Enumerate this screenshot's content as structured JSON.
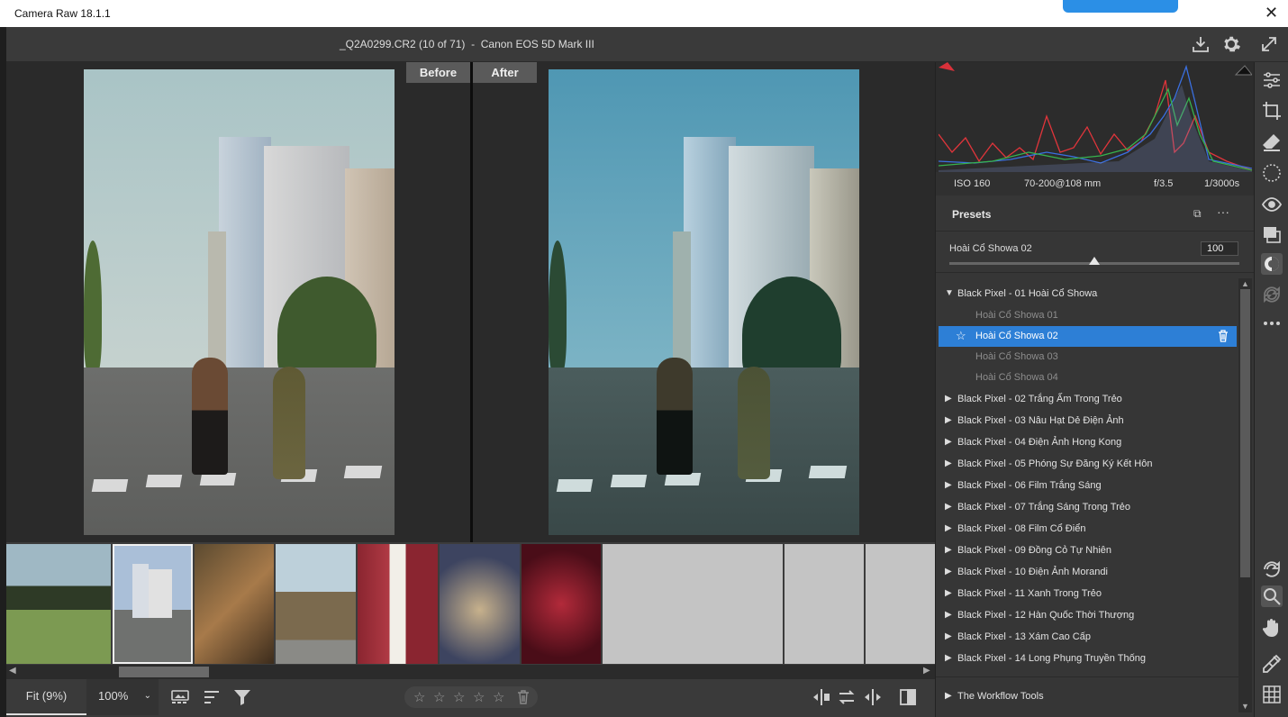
{
  "window": {
    "app_title": "Camera Raw 18.1.1"
  },
  "header": {
    "file_title": "_Q2A0299.CR2 (10 of 71)  -  Canon EOS 5D Mark III"
  },
  "preview": {
    "before_label": "Before",
    "after_label": "After"
  },
  "bottombar": {
    "zoom_fit": "Fit (9%)",
    "zoom_percent": "100%"
  },
  "camera_info": {
    "iso": "ISO 160",
    "lens": "70-200@108 mm",
    "aperture": "f/3.5",
    "shutter": "1/3000s"
  },
  "presets": {
    "title": "Presets",
    "selected_name": "Hoài Cổ Showa 02",
    "amount": "100",
    "amount_fraction": 0.5,
    "open_group": {
      "label": "Black Pixel - 01 Hoài Cổ Showa",
      "items": [
        "Hoài Cổ Showa 01",
        "Hoài Cổ Showa 02",
        "Hoài Cổ Showa 03",
        "Hoài Cổ Showa 04"
      ],
      "active_index": 1
    },
    "groups": [
      "Black Pixel - 02 Trắng Ấm Trong Trẻo",
      "Black Pixel - 03 Nâu Hạt Dẻ Điện Ảnh",
      "Black Pixel - 04 Điện Ảnh Hong Kong",
      "Black Pixel - 05 Phóng Sự Đăng Ký Kết Hôn",
      "Black Pixel - 06 Film Trắng Sáng",
      "Black Pixel - 07 Trắng Sáng Trong Trẻo",
      "Black Pixel - 08 Film Cổ Điển",
      "Black Pixel - 09 Đồng Cỏ Tự Nhiên",
      "Black Pixel - 10 Điện Ảnh Morandi",
      "Black Pixel - 11 Xanh Trong Trẻo",
      "Black Pixel - 12 Hàn Quốc Thời Thượng",
      "Black Pixel - 13 Xám Cao Cấp",
      "Black Pixel - 14 Long Phụng Truyền Thống"
    ],
    "workflow_label": "The Workflow Tools"
  },
  "colors": {
    "accent": "#2d7fd6",
    "panel": "#363636",
    "background": "#2a2a2a"
  }
}
